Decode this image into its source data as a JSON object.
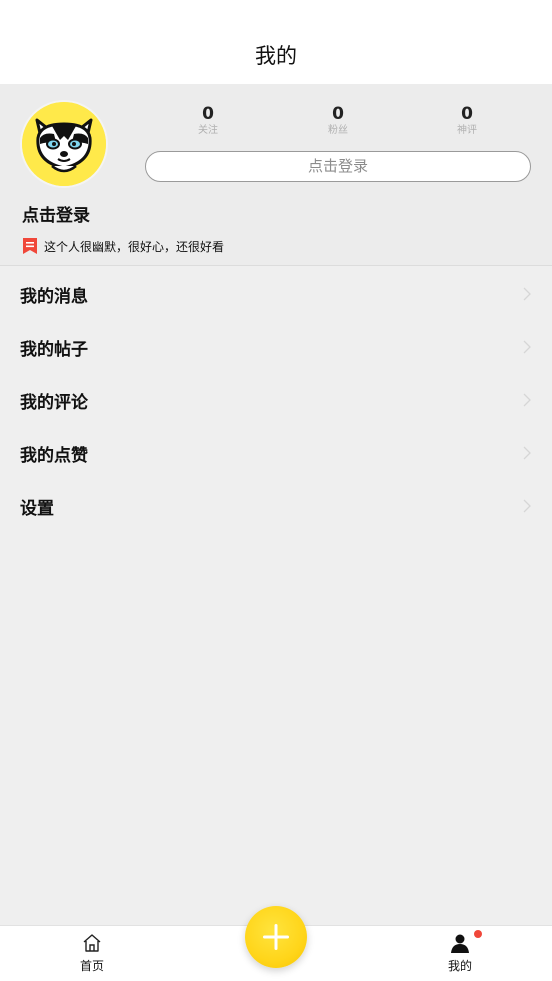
{
  "header": {
    "title": "我的"
  },
  "profile": {
    "stats": [
      {
        "value": "0",
        "label": "关注"
      },
      {
        "value": "0",
        "label": "粉丝"
      },
      {
        "value": "0",
        "label": "神评"
      }
    ],
    "login_button": "点击登录",
    "username": "点击登录",
    "bio": "这个人很幽默，很好心，还很好看",
    "avatar_bg_color": "#ffe94a"
  },
  "menu": {
    "items": [
      {
        "label": "我的消息",
        "icon": "chevron-right-icon"
      },
      {
        "label": "我的帖子",
        "icon": "chevron-right-icon"
      },
      {
        "label": "我的评论",
        "icon": "chevron-right-icon"
      },
      {
        "label": "我的点赞",
        "icon": "chevron-right-icon"
      },
      {
        "label": "设置",
        "icon": "chevron-right-icon"
      }
    ]
  },
  "tabbar": {
    "home": {
      "label": "首页",
      "icon": "home-icon"
    },
    "add": {
      "icon": "plus-icon",
      "color": "#ffd51a"
    },
    "mine": {
      "label": "我的",
      "icon": "person-icon",
      "badge_color": "#f0473a"
    }
  }
}
